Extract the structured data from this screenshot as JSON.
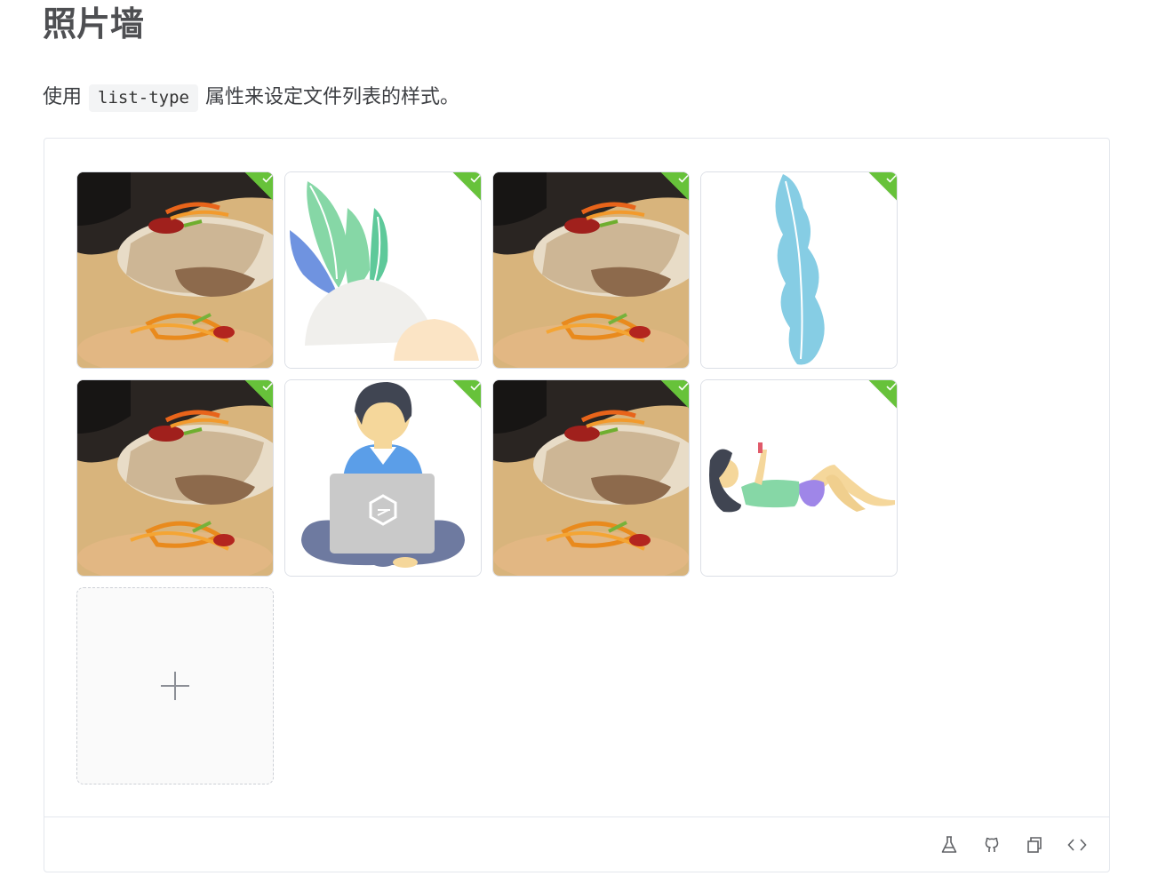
{
  "page": {
    "title": "照片墙",
    "desc_before": "使用",
    "desc_code": "list-type",
    "desc_after": "属性来设定文件列表的样式。"
  },
  "file_list": {
    "items": [
      {
        "kind": "food-photo",
        "status": "success"
      },
      {
        "kind": "plant-illustration",
        "status": "success"
      },
      {
        "kind": "food-photo",
        "status": "success"
      },
      {
        "kind": "leaf-illustration",
        "status": "success"
      },
      {
        "kind": "food-photo",
        "status": "success"
      },
      {
        "kind": "person-laptop-illustration",
        "status": "success"
      },
      {
        "kind": "food-photo",
        "status": "success"
      },
      {
        "kind": "person-reclining-illustration",
        "status": "success"
      }
    ],
    "upload_icon": "plus-icon"
  },
  "footer_toolbar": {
    "icons": [
      "flask-icon",
      "github-icon",
      "copy-icon",
      "code-icon"
    ]
  },
  "colors": {
    "success": "#67c23a",
    "border": "#dcdfe6",
    "text": "#303133"
  }
}
